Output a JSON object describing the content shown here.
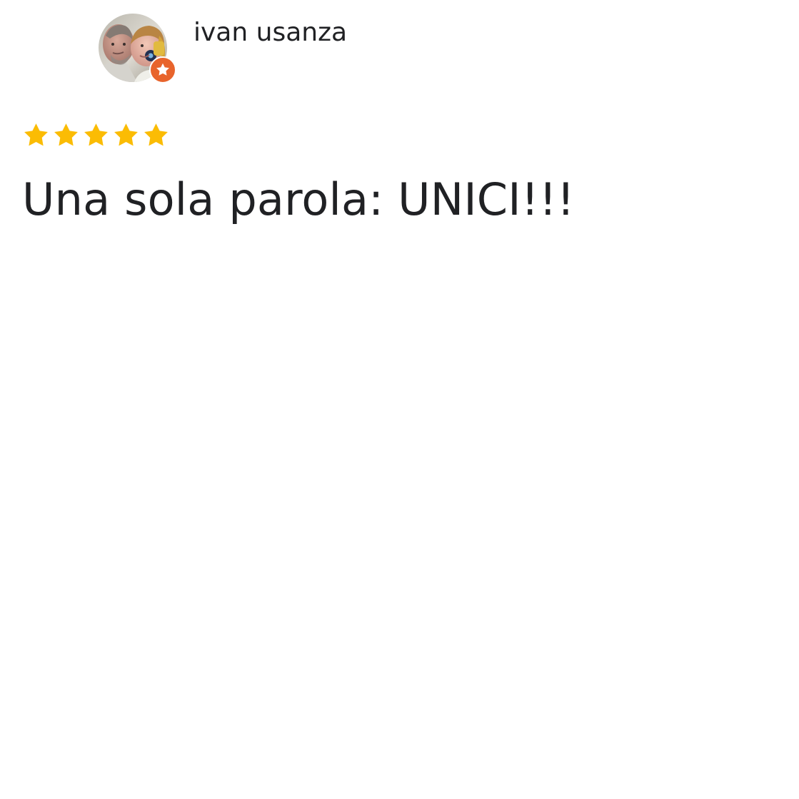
{
  "reviewer": {
    "name": "ivan usanza",
    "avatar_icon": "profile-photo",
    "badge_icon": "local-guide-star-icon"
  },
  "rating": {
    "value": 5,
    "max": 5
  },
  "review": {
    "text": "Una sola parola: UNICI!!!"
  },
  "colors": {
    "star_filled": "#fbbc04",
    "badge": "#e8642c",
    "text": "#202124",
    "background": "#ffffff"
  }
}
